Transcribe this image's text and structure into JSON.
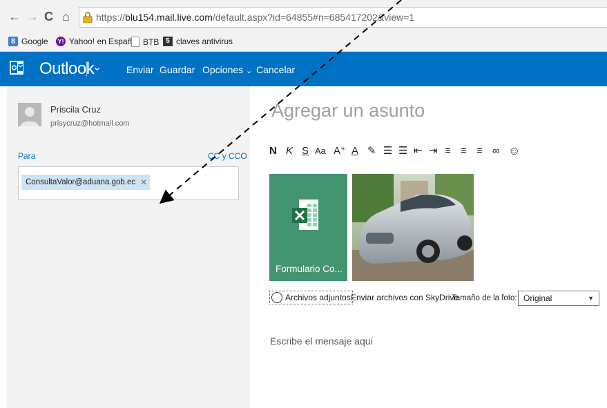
{
  "browser": {
    "url_scheme": "https://",
    "url_host": "blu154.mail.live.com",
    "url_path": "/default.aspx?id=64855#n=685417202&view=1",
    "bookmarks": [
      "Google",
      "Yahoo! en Español",
      "BTB",
      "claves antivirus"
    ]
  },
  "header": {
    "brand": "Outlook",
    "commands": [
      "Enviar",
      "Guardar",
      "Opciones",
      "Cancelar"
    ],
    "accent": "#0072c6"
  },
  "sender": {
    "name": "Priscila Cruz",
    "email": "prisycruz@hotmail.com"
  },
  "recipients": {
    "to_label": "Para",
    "cc_label": "CC y CCO",
    "chips": [
      "ConsultaValor@aduana.gob.ec"
    ]
  },
  "compose": {
    "subject_placeholder": "Agregar un asunto",
    "toolbar": [
      {
        "name": "bold-icon",
        "glyph": "N"
      },
      {
        "name": "italic-icon",
        "glyph": "K"
      },
      {
        "name": "underline-icon",
        "glyph": "S"
      },
      {
        "name": "font-size-icon",
        "glyph": "Aa"
      },
      {
        "name": "grow-font-icon",
        "glyph": "A⁺"
      },
      {
        "name": "font-color-icon",
        "glyph": "A"
      },
      {
        "name": "highlight-icon",
        "glyph": "✎"
      },
      {
        "name": "numbered-list-icon",
        "glyph": "☰"
      },
      {
        "name": "bullet-list-icon",
        "glyph": "☰"
      },
      {
        "name": "decrease-indent-icon",
        "glyph": "⇤"
      },
      {
        "name": "increase-indent-icon",
        "glyph": "⇥"
      },
      {
        "name": "align-left-icon",
        "glyph": "≡"
      },
      {
        "name": "align-center-icon",
        "glyph": "≡"
      },
      {
        "name": "align-right-icon",
        "glyph": "≡"
      },
      {
        "name": "link-icon",
        "glyph": "∞"
      },
      {
        "name": "emoji-icon",
        "glyph": "☺"
      }
    ],
    "attachment_excel_caption": "Formulario Co...",
    "attachments_link": "Archivos adjuntos",
    "skydrive_link": "Enviar archivos con SkyDrive",
    "photo_size_label": "Tamaño de la foto:",
    "photo_size_value": "Original",
    "body_placeholder": "Escribe el mensaje aquí"
  }
}
